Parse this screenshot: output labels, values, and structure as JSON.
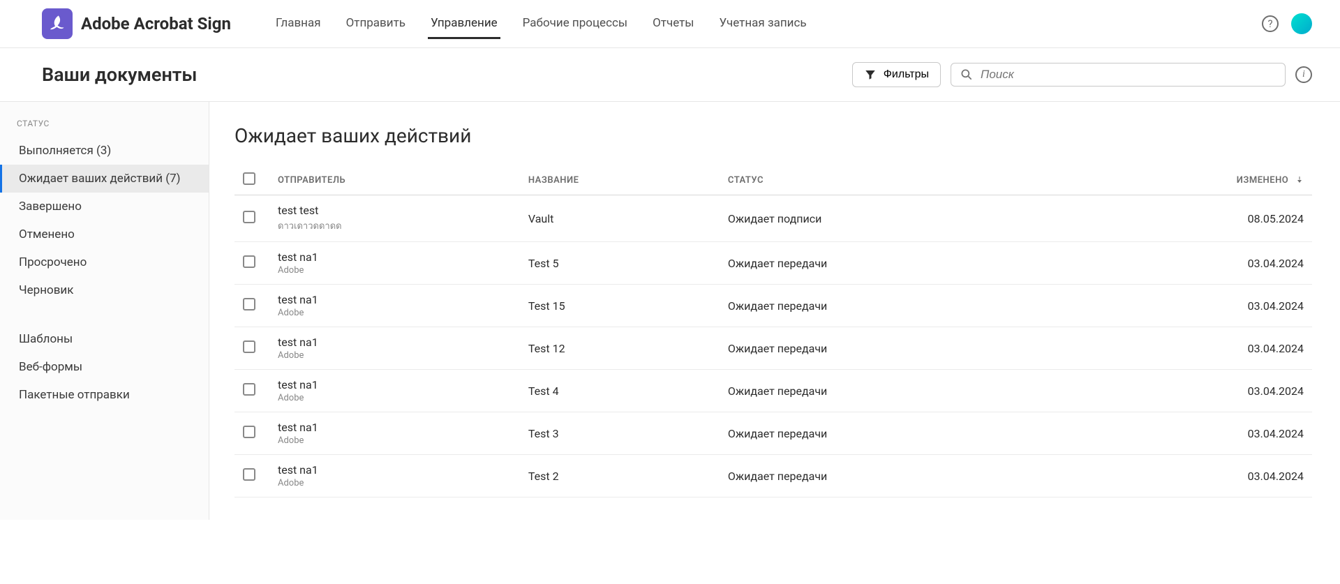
{
  "brand": {
    "name": "Adobe Acrobat Sign"
  },
  "nav": {
    "items": [
      "Главная",
      "Отправить",
      "Управление",
      "Рабочие процессы",
      "Отчеты",
      "Учетная запись"
    ],
    "active_index": 2
  },
  "page": {
    "title": "Ваши документы",
    "filter_label": "Фильтры",
    "search_placeholder": "Поиск"
  },
  "sidebar": {
    "heading": "СТАТУС",
    "status_items": [
      {
        "label": "Выполняется (3)"
      },
      {
        "label": "Ожидает ваших действий (7)",
        "selected": true
      },
      {
        "label": "Завершено"
      },
      {
        "label": "Отменено"
      },
      {
        "label": "Просрочено"
      },
      {
        "label": "Черновик"
      }
    ],
    "other_items": [
      {
        "label": "Шаблоны"
      },
      {
        "label": "Веб-формы"
      },
      {
        "label": "Пакетные отправки"
      }
    ]
  },
  "main": {
    "title": "Ожидает ваших действий",
    "columns": {
      "sender": "ОТПРАВИТЕЛЬ",
      "title": "НАЗВАНИЕ",
      "status": "СТАТУС",
      "modified": "ИЗМЕНЕНО"
    },
    "rows": [
      {
        "sender": "test test",
        "org": "ดาวเดาวดดาดด",
        "title": "Vault",
        "status": "Ожидает подписи",
        "modified": "08.05.2024"
      },
      {
        "sender": "test na1",
        "org": "Adobe",
        "title": "Test 5",
        "status": "Ожидает передачи",
        "modified": "03.04.2024"
      },
      {
        "sender": "test na1",
        "org": "Adobe",
        "title": "Test 15",
        "status": "Ожидает передачи",
        "modified": "03.04.2024"
      },
      {
        "sender": "test na1",
        "org": "Adobe",
        "title": "Test 12",
        "status": "Ожидает передачи",
        "modified": "03.04.2024"
      },
      {
        "sender": "test na1",
        "org": "Adobe",
        "title": "Test 4",
        "status": "Ожидает передачи",
        "modified": "03.04.2024"
      },
      {
        "sender": "test na1",
        "org": "Adobe",
        "title": "Test 3",
        "status": "Ожидает передачи",
        "modified": "03.04.2024"
      },
      {
        "sender": "test na1",
        "org": "Adobe",
        "title": "Test 2",
        "status": "Ожидает передачи",
        "modified": "03.04.2024"
      }
    ]
  }
}
